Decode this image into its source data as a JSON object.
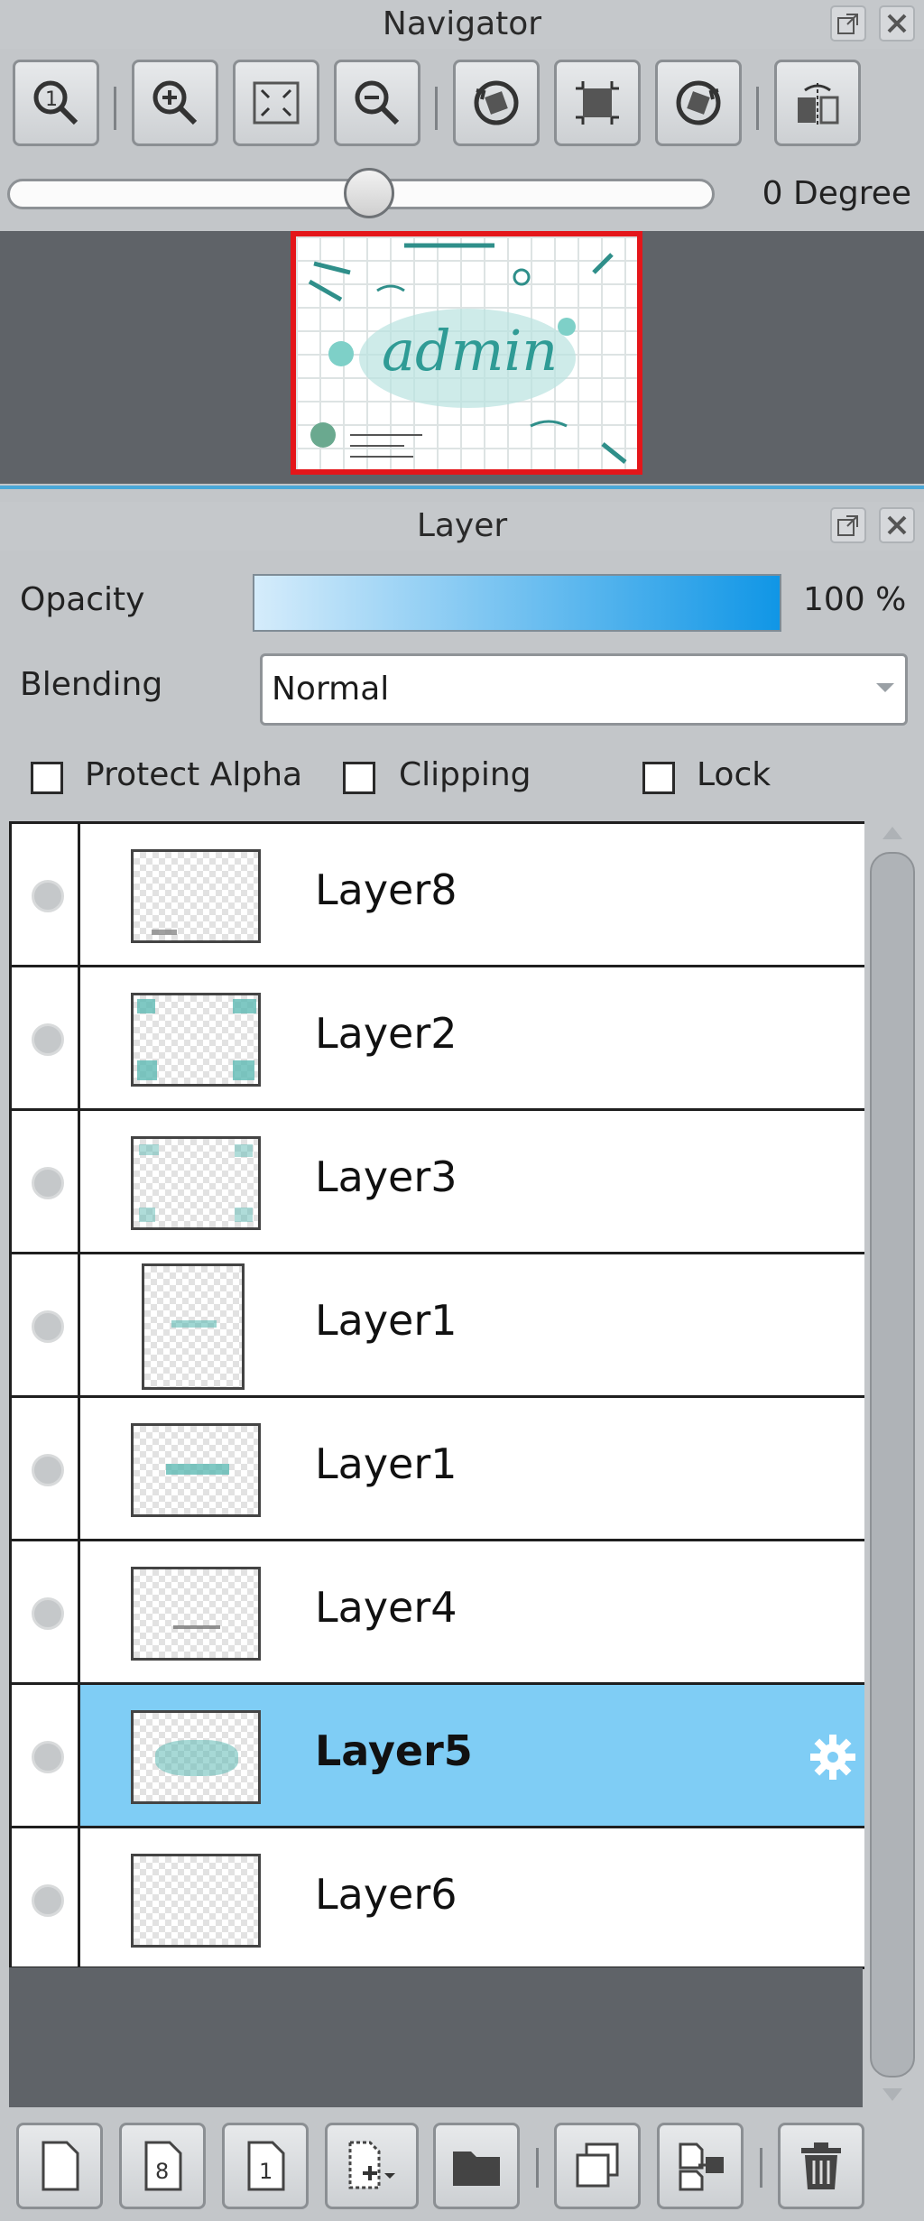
{
  "navigator": {
    "title": "Navigator",
    "degree_label": "0 Degree",
    "rotation_level": 0.5,
    "toolbar_icons": [
      "zoom-actual-size-icon",
      "zoom-in-icon",
      "fit-to-window-icon",
      "zoom-out-icon",
      "rotate-left-icon",
      "reset-rotation-icon",
      "rotate-right-icon",
      "flip-horizontal-icon"
    ],
    "preview_text": "admin"
  },
  "layer_panel": {
    "title": "Layer",
    "opacity_label": "Opacity",
    "opacity_value": "100 %",
    "blending_label": "Blending",
    "blending_value": "Normal",
    "protect_alpha_label": "Protect Alpha",
    "clipping_label": "Clipping",
    "lock_label": "Lock",
    "layers": [
      {
        "name": "Layer8",
        "selected": false
      },
      {
        "name": "Layer2",
        "selected": false
      },
      {
        "name": "Layer3",
        "selected": false
      },
      {
        "name": "Layer1",
        "selected": false
      },
      {
        "name": "Layer1",
        "selected": false
      },
      {
        "name": "Layer4",
        "selected": false
      },
      {
        "name": "Layer5",
        "selected": true
      },
      {
        "name": "Layer6",
        "selected": false
      }
    ],
    "bottom_toolbar": [
      "new-layer-icon",
      "new-8bit-layer-icon",
      "new-1bit-layer-icon",
      "add-layer-dropdown-icon",
      "new-folder-icon",
      "duplicate-layer-icon",
      "merge-down-icon",
      "delete-layer-icon"
    ]
  },
  "colors": {
    "selected_row": "#7fcdf5",
    "preview_border": "#e4161a",
    "panel_bg": "#c3c6c9",
    "accent_line": "#4aa8d8"
  }
}
